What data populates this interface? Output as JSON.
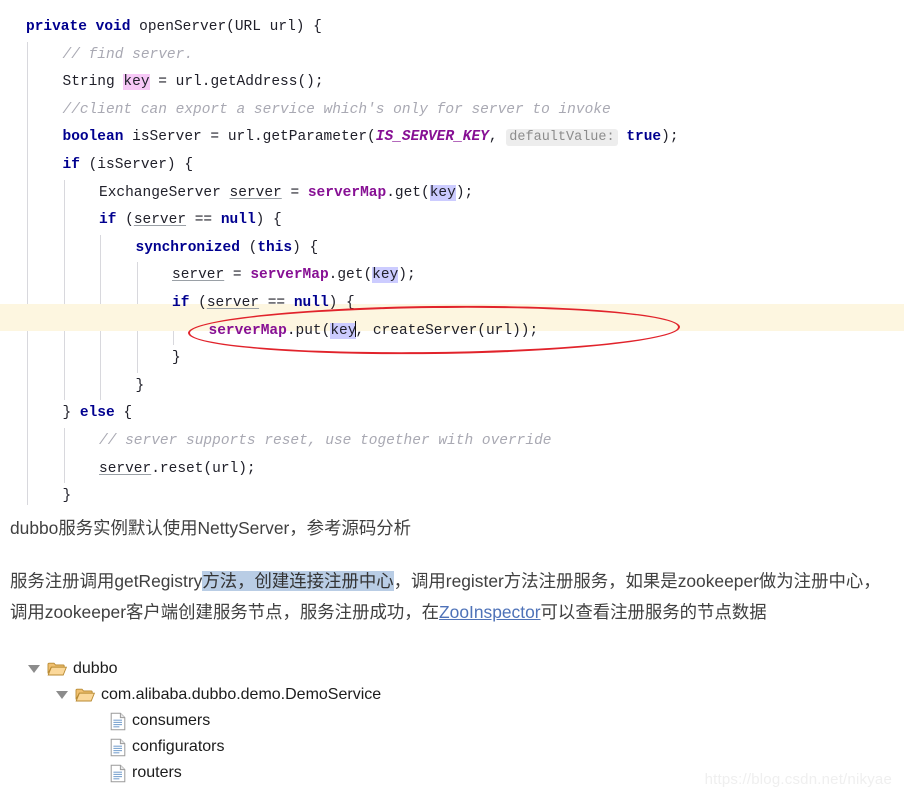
{
  "code": {
    "language": "java",
    "method_signature": "private void openServer(URL url) {",
    "lines": [
      {
        "id": "l1",
        "indent": 0,
        "tokens": [
          {
            "t": "private",
            "c": "kw"
          },
          {
            "t": " ",
            "c": "plain"
          },
          {
            "t": "void",
            "c": "kw"
          },
          {
            "t": " openServer(URL url) {",
            "c": "plain"
          }
        ]
      },
      {
        "id": "l2",
        "indent": 1,
        "tokens": [
          {
            "t": "// find server.",
            "c": "cmt"
          }
        ]
      },
      {
        "id": "l3",
        "indent": 1,
        "tokens": [
          {
            "t": "String ",
            "c": "plain"
          },
          {
            "t": "key",
            "c": "hl-key-decl"
          },
          {
            "t": " = url.getAddress();",
            "c": "plain"
          }
        ]
      },
      {
        "id": "l4",
        "indent": 1,
        "tokens": [
          {
            "t": "//client can export a service which's only for server to invoke",
            "c": "cmt"
          }
        ]
      },
      {
        "id": "l5",
        "indent": 1,
        "tokens": [
          {
            "t": "boolean",
            "c": "kw"
          },
          {
            "t": " isServer = url.getParameter(",
            "c": "plain"
          },
          {
            "t": "IS_SERVER_KEY",
            "c": "stat"
          },
          {
            "t": ", ",
            "c": "plain"
          },
          {
            "t": "defaultValue:",
            "c": "hint"
          },
          {
            "t": " ",
            "c": "plain"
          },
          {
            "t": "true",
            "c": "kw"
          },
          {
            "t": ");",
            "c": "plain"
          }
        ]
      },
      {
        "id": "l6",
        "indent": 1,
        "tokens": [
          {
            "t": "if",
            "c": "kw"
          },
          {
            "t": " (isServer) {",
            "c": "plain"
          }
        ]
      },
      {
        "id": "l7",
        "indent": 2,
        "tokens": [
          {
            "t": "ExchangeServer ",
            "c": "plain"
          },
          {
            "t": "server",
            "c": "lvar"
          },
          {
            "t": " = ",
            "c": "plain"
          },
          {
            "t": "serverMap",
            "c": "fld"
          },
          {
            "t": ".get(",
            "c": "plain"
          },
          {
            "t": "key",
            "c": "hl-key-use"
          },
          {
            "t": ");",
            "c": "plain"
          }
        ]
      },
      {
        "id": "l8",
        "indent": 2,
        "tokens": [
          {
            "t": "if",
            "c": "kw"
          },
          {
            "t": " (",
            "c": "plain"
          },
          {
            "t": "server",
            "c": "lvar"
          },
          {
            "t": " == ",
            "c": "plain"
          },
          {
            "t": "null",
            "c": "kw"
          },
          {
            "t": ") {",
            "c": "plain"
          }
        ]
      },
      {
        "id": "l9",
        "indent": 3,
        "tokens": [
          {
            "t": "synchronized",
            "c": "kw"
          },
          {
            "t": " (",
            "c": "plain"
          },
          {
            "t": "this",
            "c": "kw"
          },
          {
            "t": ") {",
            "c": "plain"
          }
        ]
      },
      {
        "id": "l10",
        "indent": 4,
        "tokens": [
          {
            "t": "server",
            "c": "lvar"
          },
          {
            "t": " = ",
            "c": "plain"
          },
          {
            "t": "serverMap",
            "c": "fld"
          },
          {
            "t": ".get(",
            "c": "plain"
          },
          {
            "t": "key",
            "c": "hl-key-use"
          },
          {
            "t": ");",
            "c": "plain"
          }
        ]
      },
      {
        "id": "l11",
        "indent": 4,
        "tokens": [
          {
            "t": "if",
            "c": "kw"
          },
          {
            "t": " (",
            "c": "plain"
          },
          {
            "t": "server",
            "c": "lvar"
          },
          {
            "t": " == ",
            "c": "plain"
          },
          {
            "t": "null",
            "c": "kw"
          },
          {
            "t": ") {",
            "c": "plain"
          }
        ]
      },
      {
        "id": "l12",
        "indent": 5,
        "highlight": true,
        "tokens": [
          {
            "t": "serverMap",
            "c": "fld"
          },
          {
            "t": ".put(",
            "c": "plain"
          },
          {
            "t": "key",
            "c": "hl-key-use"
          },
          {
            "t": "|CARET|",
            "c": "caret"
          },
          {
            "t": ", createServer(url));",
            "c": "plain"
          }
        ]
      },
      {
        "id": "l13",
        "indent": 4,
        "tokens": [
          {
            "t": "}",
            "c": "plain"
          }
        ]
      },
      {
        "id": "l14",
        "indent": 3,
        "tokens": [
          {
            "t": "}",
            "c": "plain"
          }
        ]
      },
      {
        "id": "l15",
        "indent": 1,
        "tokens": [
          {
            "t": "} ",
            "c": "plain"
          },
          {
            "t": "else",
            "c": "kw"
          },
          {
            "t": " {",
            "c": "plain"
          }
        ]
      },
      {
        "id": "l16",
        "indent": 2,
        "tokens": [
          {
            "t": "// server supports reset, use together with override",
            "c": "cmt"
          }
        ]
      },
      {
        "id": "l17",
        "indent": 2,
        "tokens": [
          {
            "t": "server",
            "c": "lvar"
          },
          {
            "t": ".reset(url);",
            "c": "plain"
          }
        ]
      },
      {
        "id": "l18",
        "indent": 1,
        "tokens": [
          {
            "t": "}",
            "c": "plain"
          }
        ]
      }
    ],
    "annotation": {
      "shape": "red-ellipse",
      "targets_line": "l12",
      "color": "#e1232b"
    },
    "highlight_color": "#fdf6e0",
    "selection_colors": {
      "declaration": "#f7c8f7",
      "usage": "#ccccff"
    }
  },
  "prose": {
    "paragraph1": "dubbo服务实例默认使用NettyServer，参考源码分析",
    "paragraph2": {
      "part1": "服务注册调用getRegistry",
      "selected": "方法，创建连接注册中心",
      "part2": "，调用register方法注册服务，如果是zookeeper做为注册中心，调用zookeeper客户端创建服务节点，服务注册成功，在",
      "link": "ZooInspector",
      "part3": "可以查看注册服务的节点数据"
    },
    "selection_color": "#b9cde5",
    "link_color": "#4e72b8"
  },
  "tree": {
    "nodes": [
      {
        "label": "dubbo",
        "type": "folder-open",
        "expanded": true,
        "depth": 0
      },
      {
        "label": "com.alibaba.dubbo.demo.DemoService",
        "type": "folder-open",
        "expanded": true,
        "depth": 1
      },
      {
        "label": "consumers",
        "type": "document",
        "expanded": false,
        "depth": 2
      },
      {
        "label": "configurators",
        "type": "document",
        "expanded": false,
        "depth": 2
      },
      {
        "label": "routers",
        "type": "document",
        "expanded": false,
        "depth": 2
      }
    ]
  },
  "watermark": "https://blog.csdn.net/nikyae"
}
